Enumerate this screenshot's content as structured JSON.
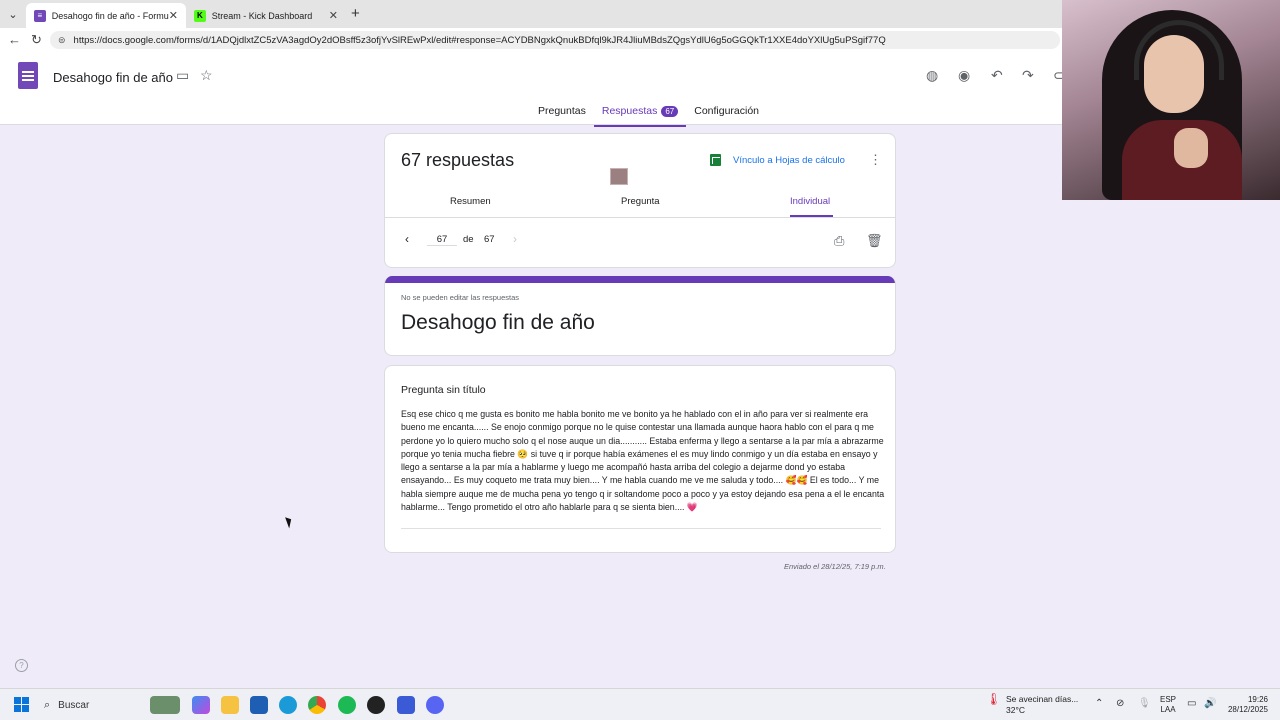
{
  "browser": {
    "tabs": [
      {
        "title": "Desahogo fin de año - Formulario",
        "active": true,
        "favicon_color": "#7248b9"
      },
      {
        "title": "Stream - Kick Dashboard",
        "active": false,
        "favicon_color": "#53fc18"
      }
    ],
    "url": "https://docs.google.com/forms/d/1ADQjdlxtZC5zVA3agdOy2dOBsff5z3ofjYvSlREwPxl/edit#response=ACYDBNgxkQnukBDfql9kJR4JliuMBdsZQgsYdlU6g5oGGQkTr1XXE4doYXlUg5uPSgif77Q"
  },
  "forms": {
    "title": "Desahogo fin de año",
    "top_tabs": [
      {
        "label": "Preguntas",
        "active": false
      },
      {
        "label": "Respuestas",
        "active": true,
        "badge": "67"
      },
      {
        "label": "Configuración",
        "active": false
      }
    ],
    "accent_color": "#673ab7"
  },
  "summary": {
    "count_label": "67 respuestas",
    "sheets_link": "Vínculo a Hojas de cálculo",
    "sub_tabs": [
      "Resumen",
      "Pregunta",
      "Individual"
    ],
    "active_sub_tab": "Individual",
    "pager": {
      "current": "67",
      "of_label": "de",
      "total": "67"
    }
  },
  "response": {
    "locked_notice": "No se pueden editar las respuestas",
    "form_title": "Desahogo fin de año",
    "question_title": "Pregunta sin título",
    "answer": "Esq ese chico q me gusta es bonito me habla bonito me ve bonito ya he hablado con el in año para ver si realmente era bueno me encanta...... Se enojo conmigo porque no le quise contestar una llamada aunque haora hablo con el para q me perdone yo lo quiero mucho solo q el nose auque un dia........... Estaba enferma y llego a sentarse a la par mía a abrazarme porque yo tenia mucha fiebre 🥺 si tuve q ir porque había exámenes el es muy lindo conmigo y un día estaba en ensayo y llego a sentarse a la par mía a hablarme y luego me acompañó hasta arriba del colegio a dejarme dond yo estaba ensayando... Es muy coqueto me trata muy bien.... Y me habla cuando me ve me saluda y todo.... 🥰🥰 El es todo... Y me habla siempre auque me de mucha pena yo tengo q ir soltandome poco a poco y ya estoy dejando esa pena a el le encanta hablarme... Tengo prometido el otro año hablarle para q se sienta bien.... 💗",
    "sent_at": "Enviado el 28/12/25, 7:19 p.m."
  },
  "taskbar": {
    "search_placeholder": "Buscar",
    "weather_line1": "Se avecinan días...",
    "weather_line2": "32°C",
    "lang_line1": "ESP",
    "lang_line2": "LAA",
    "time": "19:26",
    "date": "28/12/2025"
  }
}
